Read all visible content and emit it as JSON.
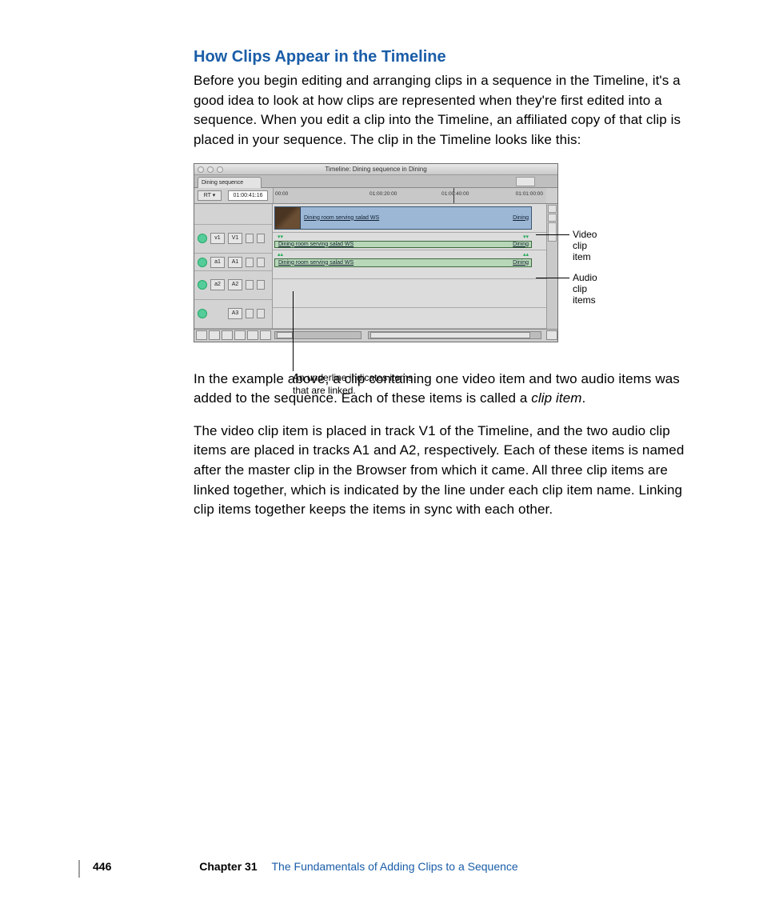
{
  "heading": "How Clips Appear in the Timeline",
  "para1": "Before you begin editing and arranging clips in a sequence in the Timeline, it's a good idea to look at how clips are represented when they're first edited into a sequence. When you edit a clip into the Timeline, an affiliated copy of that clip is placed in your sequence. The clip in the Timeline looks like this:",
  "para2_a": "In the example above, a clip containing one video item and two audio items was added to the sequence. Each of these items is called a ",
  "para2_em": "clip item",
  "para2_b": ".",
  "para3": "The video clip item is placed in track V1 of the Timeline, and the two audio clip items are placed in tracks A1 and A2, respectively. Each of these items is named after the master clip in the Browser from which it came. All three clip items are linked together, which is indicated by the line under each clip item name. Linking clip items together keeps the items in sync with each other.",
  "screenshot": {
    "window_title": "Timeline: Dining sequence in Dining",
    "sequence_tab": "Dining sequence",
    "rt_button": "RT ▾",
    "timecode": "01:00:41:16",
    "ruler": {
      "t1": "00:00",
      "t2": "01:00:20:00",
      "t3": "01:00:40:00",
      "t4": "01:01:00:00"
    },
    "tracks": {
      "v1": {
        "src": "v1",
        "dst": "V1",
        "clip_name": "Dining room serving salad WS",
        "clip_right": "Dining"
      },
      "a1": {
        "src": "a1",
        "dst": "A1",
        "clip_name": "Dining room serving salad WS",
        "clip_right": "Dining"
      },
      "a2": {
        "src": "a2",
        "dst": "A2",
        "clip_name": "Dining room serving salad WS",
        "clip_right": "Dining"
      },
      "a3": {
        "dst": "A3"
      }
    }
  },
  "callouts": {
    "video": "Video clip item",
    "audio": "Audio clip items",
    "underline": "An underline indicates items that are linked."
  },
  "footer": {
    "page": "446",
    "chapter": "Chapter 31",
    "title": "The Fundamentals of Adding Clips to a Sequence"
  }
}
